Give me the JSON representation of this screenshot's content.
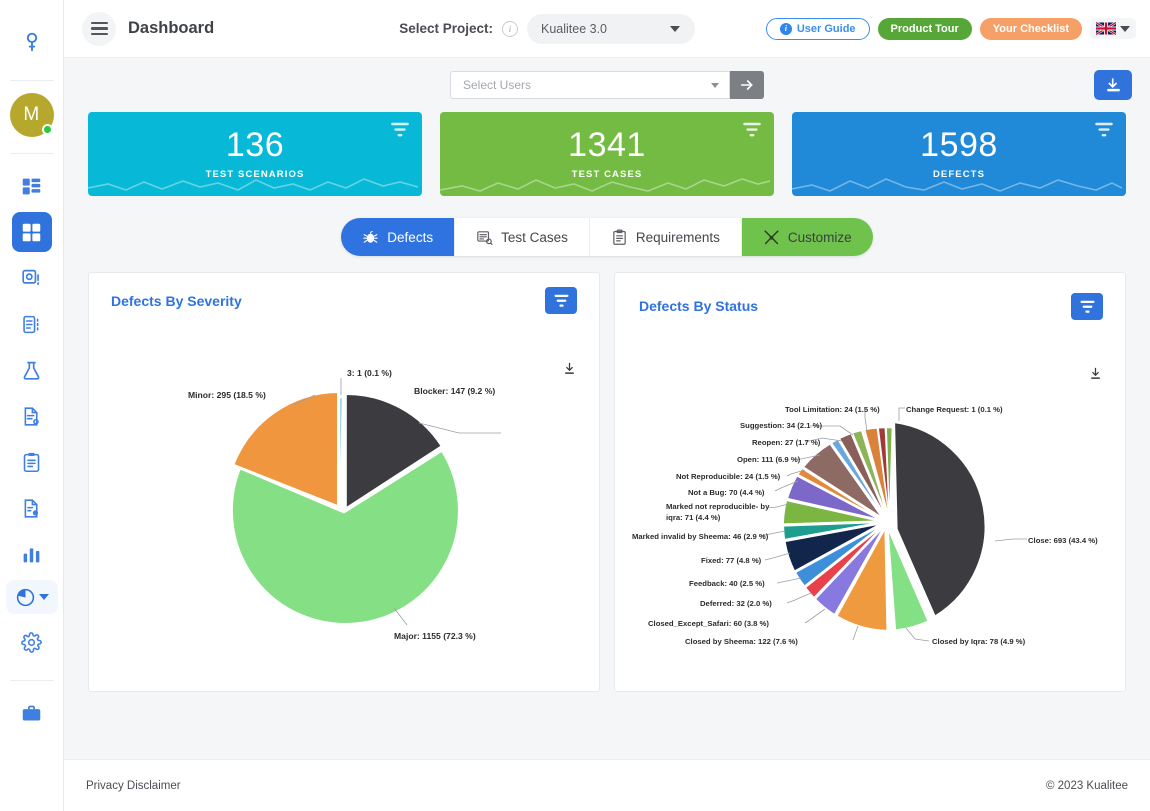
{
  "window": {
    "title": "Dashboard"
  },
  "sidebar": {
    "avatar_initial": "M",
    "items": [
      {
        "name": "search-icon",
        "label": "Search"
      },
      {
        "name": "layout-icon",
        "label": "Projects"
      },
      {
        "name": "grid-dashboard-icon",
        "label": "Dashboard"
      },
      {
        "name": "settings-module-icon",
        "label": "Modules"
      },
      {
        "name": "clipboard-check-icon",
        "label": "Test Plans"
      },
      {
        "name": "flask-icon",
        "label": "Test Lab"
      },
      {
        "name": "document-bug-icon",
        "label": "Requirements"
      },
      {
        "name": "clipboard-list-icon",
        "label": "Test Cases"
      },
      {
        "name": "report-icon",
        "label": "Reports"
      },
      {
        "name": "bar-chart-icon",
        "label": "Analytics"
      },
      {
        "name": "pie-chart-icon",
        "label": "Charts"
      },
      {
        "name": "gear-icon",
        "label": "Settings"
      },
      {
        "name": "briefcase-icon",
        "label": "Workspace"
      }
    ]
  },
  "topbar": {
    "menu_icon": "hamburger-icon",
    "page_title": "Dashboard",
    "project_label": "Select Project:",
    "project_info_icon": "info-icon",
    "project_value": "Kualitee 3.0",
    "user_guide": "User Guide",
    "product_tour": "Product Tour",
    "your_checklist": "Your Checklist",
    "language_flag": "uk-flag-icon"
  },
  "filters": {
    "users_placeholder": "Select Users",
    "go_icon": "arrow-right-icon",
    "download_icon": "download-icon"
  },
  "kpis": [
    {
      "value": "136",
      "label": "TEST SCENARIOS",
      "color": "#07b9d6"
    },
    {
      "value": "1341",
      "label": "TEST CASES",
      "color": "#74bb44"
    },
    {
      "value": "1598",
      "label": "DEFECTS",
      "color": "#2089d8"
    }
  ],
  "tabs": [
    {
      "label": "Defects",
      "icon": "bug-icon",
      "active": true
    },
    {
      "label": "Test Cases",
      "icon": "testcase-icon",
      "active": false
    },
    {
      "label": "Requirements",
      "icon": "clipboard-icon",
      "active": false
    },
    {
      "label": "Customize",
      "icon": "tools-icon",
      "active": false
    }
  ],
  "panels": {
    "severity_title": "Defects By Severity",
    "status_title": "Defects By Status",
    "filter_icon": "filter-icon",
    "download_icon": "download-icon"
  },
  "footer": {
    "left": "Privacy Disclaimer",
    "right": "© 2023 Kualitee"
  },
  "chart_data": [
    {
      "type": "pie",
      "title": "Defects By Severity",
      "total": 1598,
      "legend": "labels-outside",
      "slices": [
        {
          "label": "3",
          "value": 1,
          "percent": 0.1,
          "text": "3: 1 (0.1 %)",
          "color": "#5bc0de"
        },
        {
          "label": "Blocker",
          "value": 147,
          "percent": 9.2,
          "text": "Blocker: 147 (9.2 %)",
          "color": "#3b3b40"
        },
        {
          "label": "Major",
          "value": 1155,
          "percent": 72.3,
          "text": "Major: 1155 (72.3 %)",
          "color": "#85e085"
        },
        {
          "label": "Minor",
          "value": 295,
          "percent": 18.5,
          "text": "Minor: 295 (18.5 %)",
          "color": "#f0963f"
        }
      ]
    },
    {
      "type": "pie",
      "title": "Defects By Status",
      "total": 1598,
      "legend": "labels-outside",
      "slices": [
        {
          "label": "Change Request",
          "value": 1,
          "percent": 0.1,
          "text": "Change Request: 1 (0.1 %)",
          "color": "#8faadc"
        },
        {
          "label": "Close",
          "value": 693,
          "percent": 43.4,
          "text": "Close: 693 (43.4 %)",
          "color": "#3b3b40"
        },
        {
          "label": "Closed by Iqra",
          "value": 78,
          "percent": 4.9,
          "text": "Closed by Iqra: 78 (4.9 %)",
          "color": "#84e084"
        },
        {
          "label": "Closed by Sheema",
          "value": 122,
          "percent": 7.6,
          "text": "Closed by Sheema: 122 (7.6 %)",
          "color": "#ef9a3f"
        },
        {
          "label": "Closed_Except_Safari",
          "value": 60,
          "percent": 3.8,
          "text": "Closed_Except_Safari: 60 (3.8 %)",
          "color": "#8879e0"
        },
        {
          "label": "Deferred",
          "value": 32,
          "percent": 2.0,
          "text": "Deferred: 32 (2.0 %)",
          "color": "#e8414a"
        },
        {
          "label": "Feedback",
          "value": 40,
          "percent": 2.5,
          "text": "Feedback: 40 (2.5 %)",
          "color": "#3e8fd9"
        },
        {
          "label": "Fixed",
          "value": 77,
          "percent": 4.8,
          "text": "Fixed: 77 (4.8 %)",
          "color": "#12254a"
        },
        {
          "label": "Marked invalid by Sheema",
          "value": 46,
          "percent": 2.9,
          "text": "Marked invalid by Sheema: 46 (2.9 %)",
          "color": "#1f9e8f"
        },
        {
          "label": "Marked not reproducible- by iqra",
          "value": 71,
          "percent": 4.4,
          "text": "Marked not reproducible- by iqra: 71 (4.4 %)",
          "color": "#7bb642"
        },
        {
          "label": "Not a Bug",
          "value": 70,
          "percent": 4.4,
          "text": "Not a Bug: 70 (4.4 %)",
          "color": "#7b68c9"
        },
        {
          "label": "Not Reproducible",
          "value": 24,
          "percent": 1.5,
          "text": "Not Reproducible: 24 (1.5 %)",
          "color": "#e08a3c"
        },
        {
          "label": "Open",
          "value": 111,
          "percent": 6.9,
          "text": "Open: 111 (6.9 %)",
          "color": "#8e6a64"
        },
        {
          "label": "Reopen",
          "value": 27,
          "percent": 1.7,
          "text": "Reopen: 27 (1.7 %)",
          "color": "#67a9dd"
        },
        {
          "label": "Suggestion",
          "value": 34,
          "percent": 2.1,
          "text": "Suggestion: 34 (2.1 %)",
          "color": "#8a5f5a"
        },
        {
          "label": "Tool Limitation",
          "value": 24,
          "percent": 1.5,
          "text": "Tool Limitation: 24 (1.5 %)",
          "color": "#8db456"
        }
      ]
    }
  ]
}
